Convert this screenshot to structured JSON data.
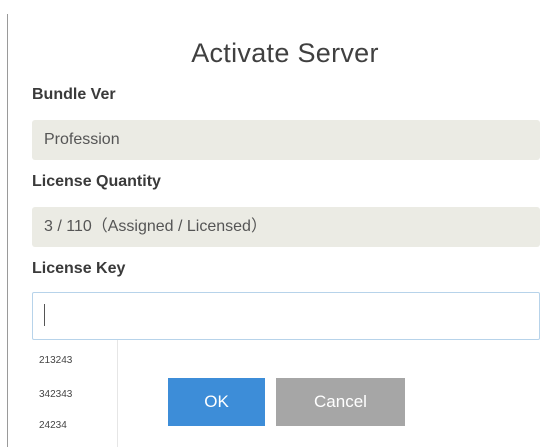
{
  "dialog": {
    "title": "Activate Server",
    "bundle": {
      "label": "Bundle Ver",
      "value": "Profession"
    },
    "license_quantity": {
      "label": "License Quantity",
      "value": "3 / 110（Assigned / Licensed）"
    },
    "license_key": {
      "label": "License Key",
      "value": "",
      "suggestions": [
        "213243",
        "342343",
        "24234"
      ]
    },
    "buttons": {
      "ok": "OK",
      "cancel": "Cancel"
    }
  },
  "colors": {
    "primary_button": "#3d8dd8",
    "secondary_button": "#a6a6a6",
    "readonly_field": "#ebebe4",
    "input_focus_border": "#b7d3ea"
  }
}
